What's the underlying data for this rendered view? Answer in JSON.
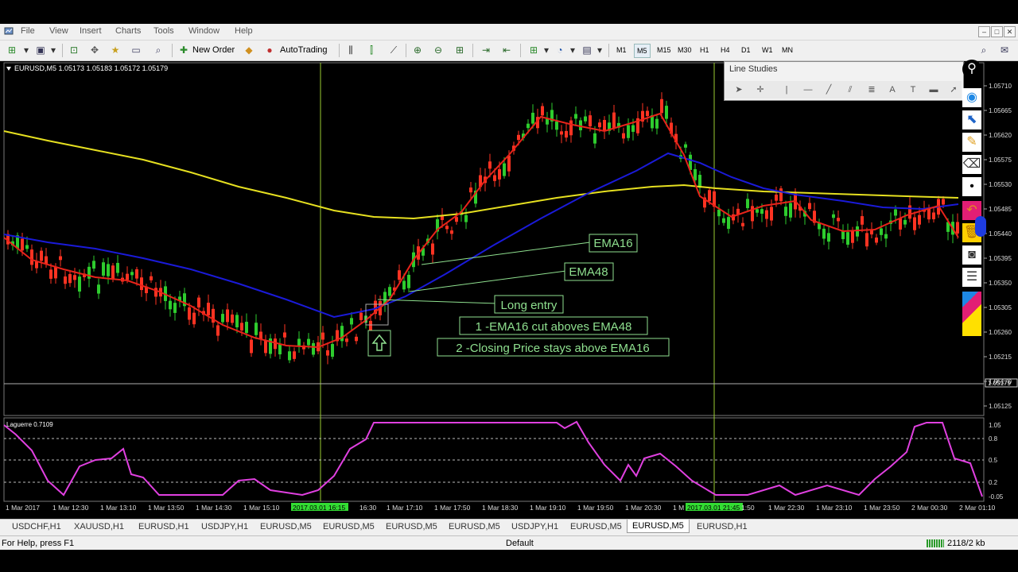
{
  "menu": {
    "items": [
      "File",
      "View",
      "Insert",
      "Charts",
      "Tools",
      "Window",
      "Help"
    ]
  },
  "toolbar": {
    "new_order_label": "New Order",
    "autotrading_label": "AutoTrading",
    "timeframes": [
      "M1",
      "M5",
      "M15",
      "M30",
      "H1",
      "H4",
      "D1",
      "W1",
      "MN"
    ],
    "active_timeframe": "M5"
  },
  "chart": {
    "symbol_info": "EURUSD,M5  1.05173 1.05183 1.05172 1.05179",
    "current_price_label": "1.05179",
    "price_ticks": [
      "1.05710",
      "1.05665",
      "1.05620",
      "1.05575",
      "1.05530",
      "1.05485",
      "1.05440",
      "1.05395",
      "1.05350",
      "1.05305",
      "1.05260",
      "1.05215",
      "1.05170",
      "1.05125"
    ],
    "indicator_label": "Laguerre 0.7109",
    "indicator_ticks": [
      "1.05",
      "0.8",
      "0.5",
      "0.2",
      "-0.05"
    ],
    "time_labels": [
      "1 Mar 2017",
      "1 Mar 12:30",
      "1 Mar 13:10",
      "1 Mar 13:50",
      "1 Mar 14:30",
      "1 Mar 15:10",
      "2017.03.01 16:15",
      "16:30",
      "1 Mar 17:10",
      "1 Mar 17:50",
      "1 Mar 18:30",
      "1 Mar 19:10",
      "1 Mar 19:50",
      "1 Mar 20:30",
      "1 M",
      "2017.03.01 21:45",
      "1:50",
      "1 Mar 22:30",
      "1 Mar 23:10",
      "1 Mar 23:50",
      "2 Mar 00:30",
      "2 Mar 01:10"
    ],
    "annotations": {
      "ema16": "EMA16",
      "ema48": "EMA48",
      "long_entry": "Long entry",
      "rule1": "1 -EMA16 cut aboves EMA48",
      "rule2": "2 -Closing Price stays above EMA16"
    },
    "colors": {
      "ema16": "#e8231a",
      "ema48": "#1a1ad8",
      "sma": "#e6e020",
      "bull": "#2ecc2e",
      "bear": "#ff3322",
      "laguerre": "#e040e0",
      "annotation": "#8fe08f"
    }
  },
  "line_studies": {
    "title": "Line Studies",
    "tools": [
      "cursor-icon",
      "crosshair-icon",
      "vertical-line-icon",
      "horizontal-line-icon",
      "trendline-icon",
      "channel-icon",
      "fibonacci-icon",
      "text-icon",
      "label-icon",
      "rectangle-icon",
      "arrow-icon"
    ]
  },
  "sidebar_tools": [
    "lightbulb-icon",
    "eye-icon",
    "cursor-icon",
    "ruler-icon",
    "eraser-icon",
    "dot-icon",
    "undo-icon",
    "trash-icon",
    "camera-icon",
    "list-icon",
    "color-palette-icon"
  ],
  "tabs": [
    "USDCHF,H1",
    "XAUUSD,H1",
    "EURUSD,H1",
    "USDJPY,H1",
    "EURUSD,M5",
    "EURUSD,M5",
    "EURUSD,M5",
    "EURUSD,M5",
    "USDJPY,H1",
    "EURUSD,M5",
    "EURUSD,M5",
    "EURUSD,H1"
  ],
  "active_tab_index": 10,
  "status": {
    "help": "For Help, press F1",
    "profile": "Default",
    "traffic": "2118/2 kb"
  }
}
